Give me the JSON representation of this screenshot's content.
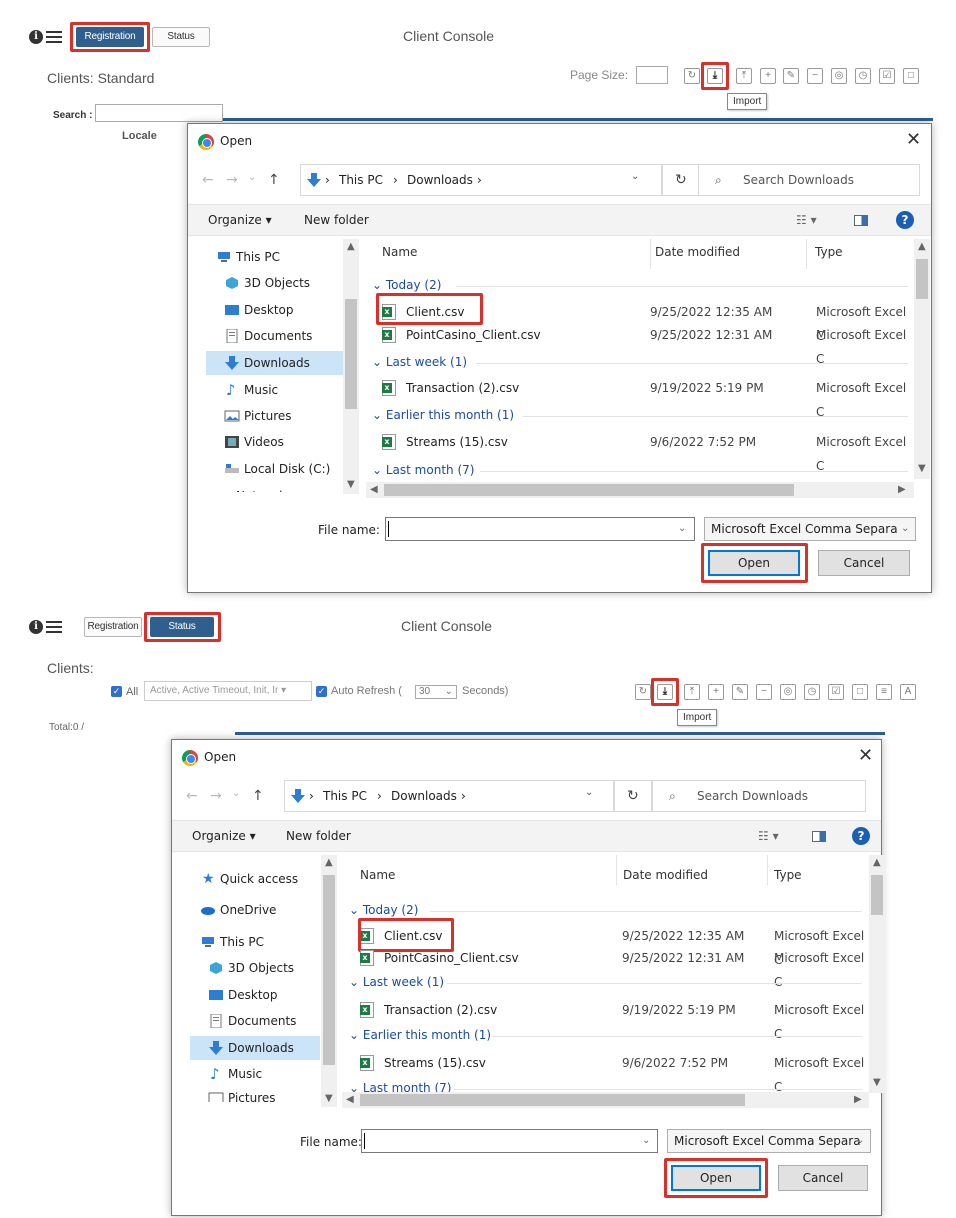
{
  "colors": {
    "highlight": "#d6312b",
    "primary_blue": "#2f5f8f",
    "selection": "#cce4f7",
    "link_blue": "#1a4ba0"
  },
  "console": {
    "title": "Client Console",
    "tab_registration": "Registration",
    "tab_status": "Status",
    "tooltip_import": "Import"
  },
  "panel1": {
    "clients_label": "Clients: Standard",
    "page_size_label": "Page Size:",
    "search_label": "Search :",
    "locale_header": "Locale"
  },
  "panel2": {
    "clients_label": "Clients:",
    "all_label": "All",
    "status_filter": "Active, Active Timeout, Init, Ir",
    "auto_refresh": "Auto Refresh (",
    "refresh_value": "30",
    "seconds": "Seconds)",
    "total": "Total:0 /"
  },
  "dialog": {
    "title": "Open",
    "crumb_this_pc": "This PC",
    "crumb_downloads": "Downloads",
    "search_placeholder": "Search Downloads",
    "organize": "Organize ▾",
    "new_folder": "New folder",
    "col_name": "Name",
    "col_date": "Date modified",
    "col_type": "Type",
    "file_name_label": "File name:",
    "file_type": "Microsoft Excel Comma Separa",
    "open_button": "Open",
    "cancel_button": "Cancel",
    "groups": {
      "today": "Today (2)",
      "last_week": "Last week (1)",
      "earlier_month": "Earlier this month (1)",
      "last_month": "Last month (7)"
    },
    "files": [
      {
        "name": "Client.csv",
        "date": "9/25/2022 12:35 AM",
        "type": "Microsoft Excel C"
      },
      {
        "name": "PointCasino_Client.csv",
        "date": "9/25/2022 12:31 AM",
        "type": "Microsoft Excel C"
      },
      {
        "name": "Transaction (2).csv",
        "date": "9/19/2022 5:19 PM",
        "type": "Microsoft Excel C"
      },
      {
        "name": "Streams (15).csv",
        "date": "9/6/2022 7:52 PM",
        "type": "Microsoft Excel C"
      }
    ],
    "nav1": [
      "This PC",
      "3D Objects",
      "Desktop",
      "Documents",
      "Downloads",
      "Music",
      "Pictures",
      "Videos",
      "Local Disk (C:)",
      "Network"
    ],
    "nav2": [
      "Quick access",
      "OneDrive",
      "This PC",
      "3D Objects",
      "Desktop",
      "Documents",
      "Downloads",
      "Music",
      "Pictures"
    ]
  }
}
